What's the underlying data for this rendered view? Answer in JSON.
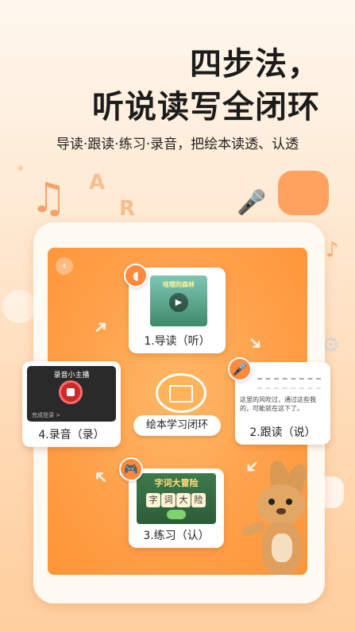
{
  "headline": {
    "line1": "四步法，",
    "line2": "听说读写全闭环"
  },
  "subtitle": "导读·跟读·练习·录音，把绘本读透、认透",
  "screen": {
    "back_icon": "chevron-left-icon",
    "center_label": "绘本学习闭环",
    "steps": [
      {
        "label": "1.导读（听）",
        "icon": "ear-icon",
        "book_title": "哇哦的森林"
      },
      {
        "label": "2.跟读（说）",
        "icon": "microphone-icon",
        "text": "这里的风吹过，通过这些我的，可能就在这下了。"
      },
      {
        "label": "3.练习（认）",
        "icon": "gamepad-icon",
        "game_title": "字词大冒险",
        "chars": [
          "字",
          "词",
          "大",
          "险"
        ]
      },
      {
        "label": "4.录音（录）",
        "icon": "record-icon",
        "app_title": "录音小主播",
        "action": "完成登录 >"
      }
    ]
  },
  "colors": {
    "accent": "#ff8a3d",
    "screen": "#ffa04a",
    "bg_top": "#fff7ee",
    "bg_bottom": "#ffcf9e"
  }
}
